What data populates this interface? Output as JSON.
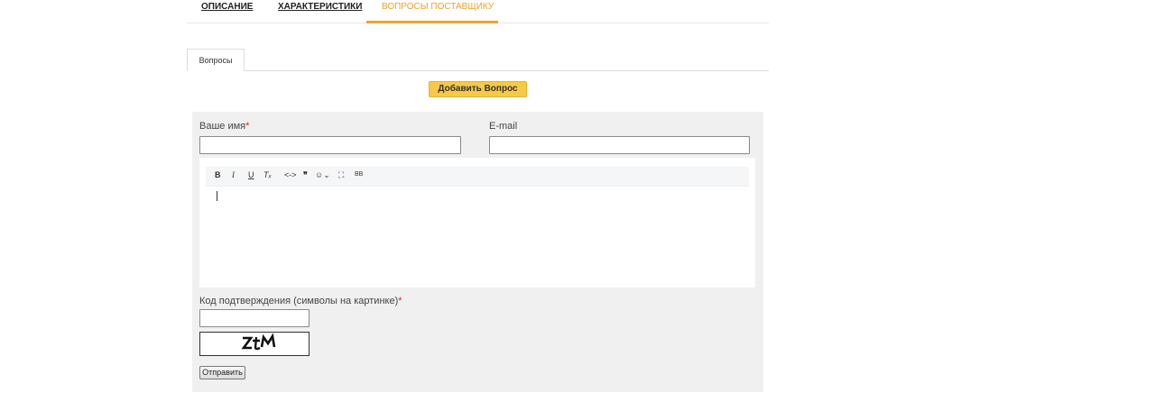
{
  "top_tabs": {
    "description": "ОПИСАНИЕ",
    "characteristics": "ХАРАКТЕРИСТИКИ",
    "questions": "ВОПРОСЫ ПОСТАВЩИКУ"
  },
  "sub_tabs": {
    "questions": "Вопросы"
  },
  "add_question_button": "Добавить Вопрос",
  "form": {
    "name_label": "Ваше имя",
    "email_label": "E-mail",
    "required_mark": "*",
    "name_value": "",
    "email_value": "",
    "editor_toolbar": [
      {
        "name": "bold-button",
        "glyph": "B"
      },
      {
        "name": "italic-button",
        "glyph": "I"
      },
      {
        "name": "underline-button",
        "glyph": "U"
      },
      {
        "name": "clear-format-button",
        "glyph": "Tₓ"
      },
      {
        "name": "code-button",
        "glyph": "<->"
      },
      {
        "name": "quote-button",
        "glyph": "❞"
      },
      {
        "name": "emoji-button",
        "glyph": "☺⌄"
      },
      {
        "name": "fullscreen-button",
        "glyph": "⛶"
      },
      {
        "name": "bbcode-button",
        "glyph": "BB"
      }
    ],
    "captcha_label": "Код подтверждения (символы на картинке)",
    "captcha_value": "",
    "captcha_text": "ZtM",
    "submit_label": "Отправить"
  },
  "colors": {
    "accent": "#f0a12a",
    "button_yellow": "#f7c948",
    "panel_bg": "#f0f0f0",
    "required": "#e02020"
  }
}
